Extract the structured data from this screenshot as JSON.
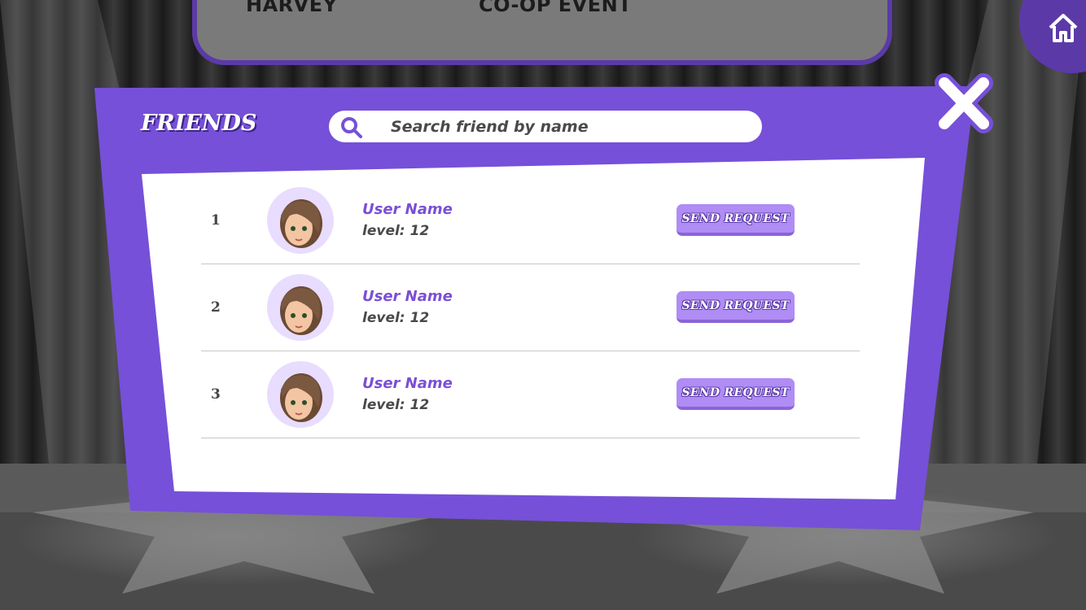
{
  "top_bar": {
    "left_label": "HARVEY",
    "right_label": "CO-OP EVENT"
  },
  "home_button": {
    "icon": "home-icon"
  },
  "dialog": {
    "title": "FRIENDS",
    "search": {
      "placeholder": "Search friend by name",
      "value": "",
      "icon": "search-icon"
    },
    "close_icon": "close-icon",
    "rows": [
      {
        "rank": "1",
        "name": "User Name",
        "level_label": "level:",
        "level_value": "12",
        "button_label": "SEND REQUEST"
      },
      {
        "rank": "2",
        "name": "User Name",
        "level_label": "level:",
        "level_value": "12",
        "button_label": "SEND REQUEST"
      },
      {
        "rank": "3",
        "name": "User Name",
        "level_label": "level:",
        "level_value": "12",
        "button_label": "SEND REQUEST"
      }
    ]
  },
  "colors": {
    "accent_purple": "#7650d8",
    "button_purple": "#b08cf5",
    "name_purple": "#7a4fd6",
    "panel_white": "#ffffff"
  }
}
